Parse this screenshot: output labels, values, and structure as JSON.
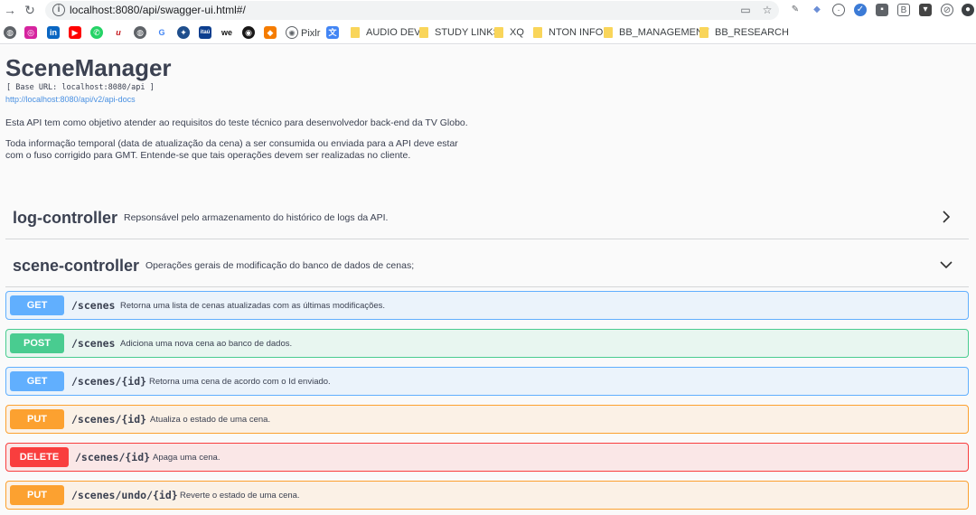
{
  "browser": {
    "url": "localhost:8080/api/swagger-ui.html#/",
    "bookmarks": {
      "pixlr": "Pixlr",
      "folders": [
        "AUDIO DEV",
        "STUDY LINKS",
        "XQ",
        "NTON INFO",
        "BB_MANAGEMENT",
        "BB_RESEARCH"
      ]
    }
  },
  "api": {
    "title": "SceneManager",
    "base_url": "[ Base URL: localhost:8080/api ]",
    "docs_link": "http://localhost:8080/api/v2/api-docs",
    "description_1": "Esta API tem como objetivo atender ao requisitos do teste técnico para desenvolvedor back-end da TV Globo.",
    "description_2a": "Toda informação temporal (data de atualização da cena) a ser consumida ou enviada para a API deve estar",
    "description_2b": "com o fuso corrigido para GMT. Entende-se que tais operações devem ser realizadas no cliente."
  },
  "tags": [
    {
      "name": "log-controller",
      "description": "Repsonsável pelo armazenamento do histórico de logs da API.",
      "expanded": false
    },
    {
      "name": "scene-controller",
      "description": "Operações gerais de modificação do banco de dados de cenas;",
      "expanded": true
    }
  ],
  "operations": [
    {
      "method": "GET",
      "path": "/scenes",
      "summary": "Retorna uma lista de cenas atualizadas com as últimas modificações."
    },
    {
      "method": "POST",
      "path": "/scenes",
      "summary": "Adiciona uma nova cena ao banco de dados."
    },
    {
      "method": "GET",
      "path": "/scenes/{id}",
      "summary": "Retorna uma cena de acordo com o Id enviado."
    },
    {
      "method": "PUT",
      "path": "/scenes/{id}",
      "summary": "Atualiza o estado de uma cena."
    },
    {
      "method": "DELETE",
      "path": "/scenes/{id}",
      "summary": "Apaga uma cena."
    },
    {
      "method": "PUT",
      "path": "/scenes/undo/{id}",
      "summary": "Reverte o estado de uma cena."
    }
  ],
  "colors": {
    "get": "#61affe",
    "post": "#49cc90",
    "put": "#fca130",
    "delete": "#f93e3e"
  }
}
